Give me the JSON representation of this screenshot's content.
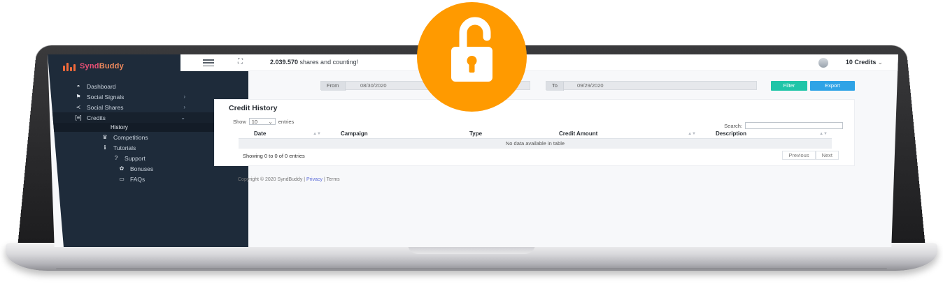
{
  "brand": {
    "name_part1": "Synd",
    "name_part2": "Buddy",
    "accent": "#e94f75"
  },
  "topbar": {
    "menu_icon": "hamburger-icon",
    "expand_icon": "fullscreen-icon",
    "shares_count": "2.039.570",
    "shares_suffix": " shares and counting!",
    "credits_label": "10 Credits",
    "credits_caret": "⌄"
  },
  "sidebar": {
    "items": [
      {
        "label": "Dashboard",
        "icon": "dashboard-icon"
      },
      {
        "label": "Social Signals",
        "icon": "signal-icon",
        "chevron": "›"
      },
      {
        "label": "Social Shares",
        "icon": "share-icon",
        "chevron": "›"
      },
      {
        "label": "Credits",
        "icon": "credits-icon",
        "chevron": "⌄"
      },
      {
        "label": "History",
        "icon": ""
      },
      {
        "label": "Competitions",
        "icon": "trophy-icon"
      },
      {
        "label": "Tutorials",
        "icon": "info-icon"
      },
      {
        "label": "Support",
        "icon": "question-icon"
      },
      {
        "label": "Bonuses",
        "icon": "gift-icon"
      },
      {
        "label": "FAQs",
        "icon": "chat-icon"
      }
    ]
  },
  "filter": {
    "from_label": "From",
    "from_value": "08/30/2020",
    "to_label": "To",
    "to_value": "09/29/2020",
    "filter_button": "Filter",
    "export_button": "Export"
  },
  "card": {
    "title": "Credit History",
    "show_label": "Show",
    "show_value": "10",
    "entries_label": "entries",
    "search_label": "Search:",
    "columns": [
      "Date",
      "Campaign",
      "Type",
      "Credit Amount",
      "Description"
    ],
    "empty_text": "No data available in table",
    "showing_text": "Showing 0 to 0 of 0 entries",
    "prev_label": "Previous",
    "next_label": "Next"
  },
  "footer": {
    "copyright": "Copyright © 2020 SyndBuddy | ",
    "privacy": "Privacy",
    "sep": " | ",
    "terms": "Terms"
  },
  "badge": {
    "icon": "unlocked-padlock-icon",
    "color": "#ff9a00"
  }
}
